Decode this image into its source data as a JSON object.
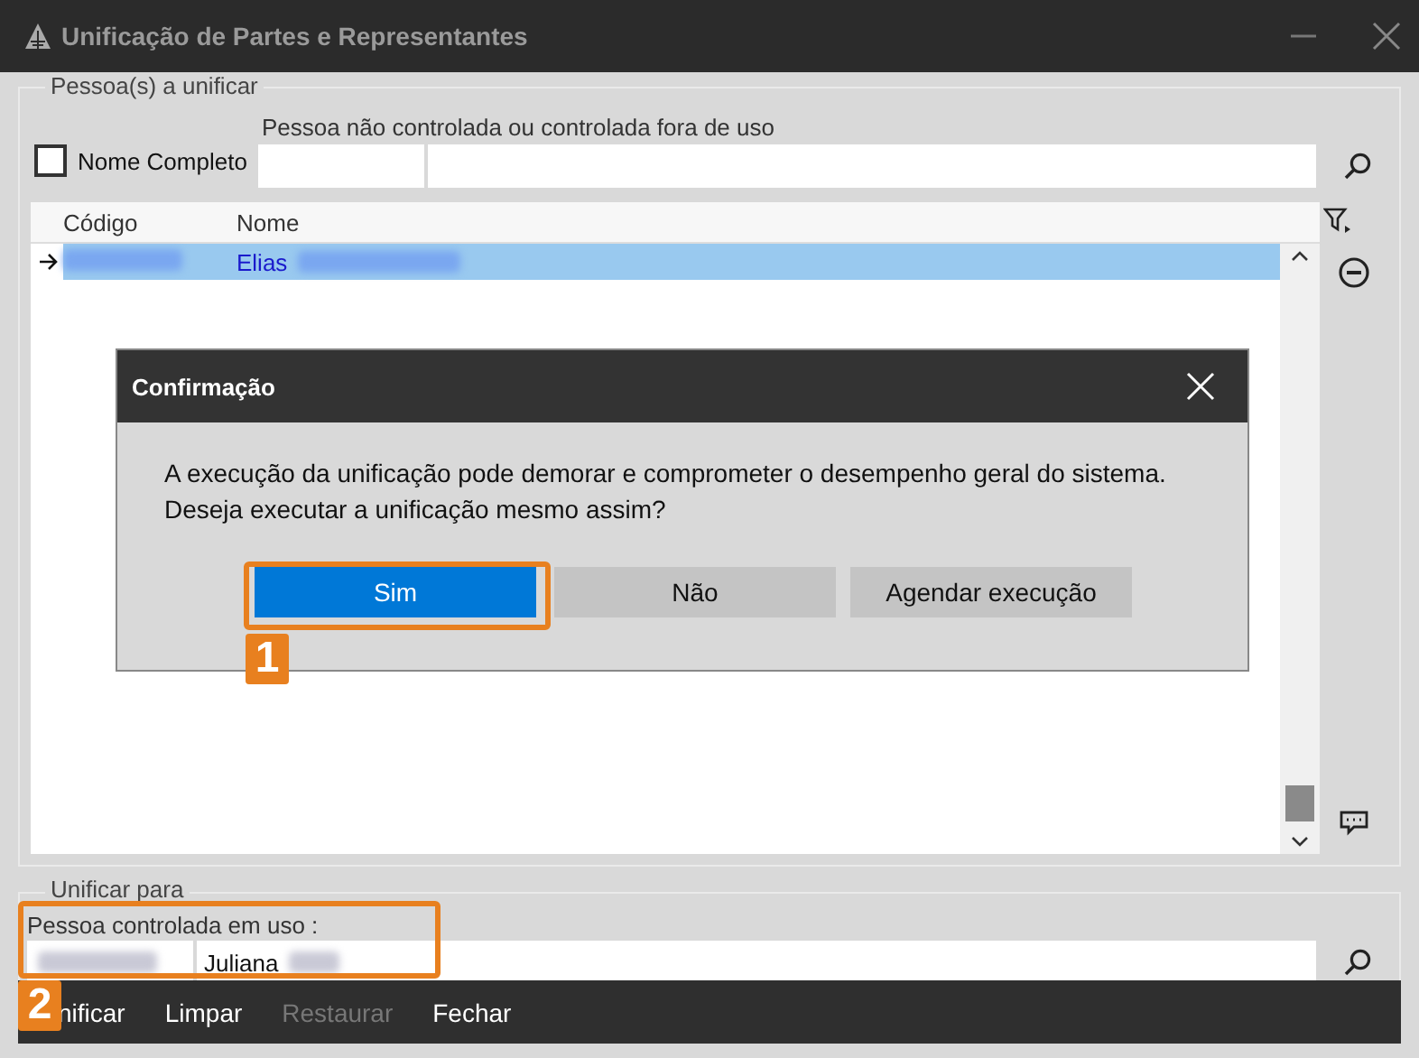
{
  "window": {
    "title": "Unificação de Partes e Representantes"
  },
  "source_group": {
    "title": "Pessoa(s) a unificar",
    "full_name_checkbox": {
      "label": "Nome Completo",
      "checked": false
    },
    "search_label": "Pessoa não controlada ou controlada fora de uso",
    "grid": {
      "columns": [
        "Código",
        "Nome"
      ],
      "rows": [
        {
          "name": "Elias",
          "selected": true
        }
      ]
    }
  },
  "dialog": {
    "title": "Confirmação",
    "message": [
      "A execução da unificação pode demorar e comprometer o desempenho geral do sistema.",
      "Deseja executar a unificação mesmo assim?"
    ],
    "buttons": [
      {
        "label": "Sim",
        "selected": true
      },
      {
        "label": "Não",
        "selected": false
      },
      {
        "label": "Agendar execução",
        "selected": false
      }
    ]
  },
  "target_group": {
    "title": "Unificar para",
    "label": "Pessoa controlada em uso :",
    "name": "Juliana"
  },
  "toolbar": [
    {
      "label": "nificar",
      "disabled": false
    },
    {
      "label": "Limpar",
      "disabled": false
    },
    {
      "label": "Restaurar",
      "disabled": true
    },
    {
      "label": "Fechar",
      "disabled": false
    }
  ],
  "annotations": [
    {
      "label": "1"
    },
    {
      "label": "2"
    }
  ]
}
